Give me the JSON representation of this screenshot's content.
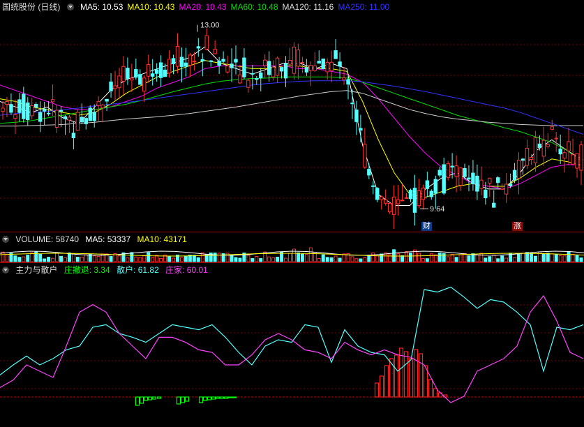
{
  "colors": {
    "up": "#ff3232",
    "down": "#54ffff",
    "ma5": "#ffffff",
    "ma10": "#ffff00",
    "ma20": "#ff00ff",
    "ma60": "#00e000",
    "ma120": "#cccccc",
    "ma250": "#3333ff",
    "grid": "#7a0000",
    "retreat": "#00ff00"
  },
  "price_panel": {
    "title": "国统股份 (日线)",
    "ma": [
      {
        "label": "MA5: 10.53",
        "color": "#ffffff"
      },
      {
        "label": "MA10: 10.43",
        "color": "#ffff00"
      },
      {
        "label": "MA20: 10.43",
        "color": "#ff00ff"
      },
      {
        "label": "MA60: 10.48",
        "color": "#00e000"
      },
      {
        "label": "MA120: 11.16",
        "color": "#dddddd"
      },
      {
        "label": "MA250: 11.00",
        "color": "#3333ff"
      }
    ],
    "high_label": "13.00",
    "low_label": "9.64",
    "tag_cai": "财",
    "tag_zhang": "涨"
  },
  "volume_panel": {
    "label": "VOLUME: 58740",
    "ma5": "MA5: 53337",
    "ma10": "MA10: 43171"
  },
  "indicator_panel": {
    "title": "主力与散户",
    "retreat": "庄撤退: 3.34",
    "retail": "散户: 61.82",
    "dealer": "庄家: 60.01"
  },
  "chart_data": {
    "type": "line",
    "title": "国统股份 (日线)",
    "price_extremes": {
      "high": 13.0,
      "low": 9.64
    },
    "last_values": {
      "MA5": 10.53,
      "MA10": 10.43,
      "MA20": 10.43,
      "MA60": 10.48,
      "MA120": 11.16,
      "MA250": 11.0
    },
    "series": [
      {
        "name": "MA5",
        "values": [
          11.6,
          11.5,
          11.4,
          11.5,
          11.3,
          11.2,
          11.5,
          11.8,
          12.0,
          12.1,
          12.2,
          12.3,
          12.4,
          12.6,
          12.3,
          12.2,
          12.1,
          12.2,
          12.3,
          12.3,
          12.2,
          12.3,
          12.2,
          10.8,
          9.9,
          9.7,
          9.7,
          10.0,
          10.2,
          10.3,
          10.1,
          10.0,
          10.0,
          10.3,
          10.7,
          10.9,
          10.7,
          10.53
        ]
      },
      {
        "name": "MA10",
        "values": [
          11.65,
          11.6,
          11.5,
          11.45,
          11.4,
          11.35,
          11.4,
          11.55,
          11.75,
          11.9,
          12.05,
          12.15,
          12.25,
          12.35,
          12.3,
          12.25,
          12.2,
          12.2,
          12.25,
          12.25,
          12.2,
          12.2,
          12.15,
          11.6,
          10.9,
          10.3,
          9.9,
          9.85,
          9.95,
          10.05,
          10.1,
          10.05,
          10.05,
          10.2,
          10.4,
          10.55,
          10.5,
          10.43
        ]
      },
      {
        "name": "MA20",
        "values": [
          11.9,
          11.8,
          11.7,
          11.6,
          11.5,
          11.45,
          11.45,
          11.5,
          11.6,
          11.7,
          11.85,
          11.95,
          12.05,
          12.2,
          12.25,
          12.25,
          12.25,
          12.25,
          12.25,
          12.2,
          12.2,
          12.15,
          12.1,
          11.95,
          11.65,
          11.3,
          10.95,
          10.65,
          10.4,
          10.25,
          10.1,
          10.05,
          10.0,
          10.1,
          10.25,
          10.4,
          10.45,
          10.43
        ]
      },
      {
        "name": "MA60",
        "values": [
          11.2,
          11.22,
          11.25,
          11.3,
          11.35,
          11.4,
          11.45,
          11.5,
          11.55,
          11.62,
          11.7,
          11.78,
          11.85,
          11.92,
          11.97,
          12.0,
          12.02,
          12.03,
          12.05,
          12.05,
          12.05,
          12.05,
          12.03,
          11.95,
          11.85,
          11.75,
          11.65,
          11.55,
          11.45,
          11.35,
          11.27,
          11.2,
          11.12,
          11.05,
          10.95,
          10.85,
          10.7,
          10.48
        ]
      },
      {
        "name": "MA120",
        "values": [
          11.15,
          11.15,
          11.16,
          11.17,
          11.18,
          11.2,
          11.22,
          11.25,
          11.28,
          11.3,
          11.32,
          11.35,
          11.38,
          11.42,
          11.46,
          11.5,
          11.55,
          11.6,
          11.65,
          11.7,
          11.74,
          11.78,
          11.8,
          11.75,
          11.65,
          11.55,
          11.45,
          11.38,
          11.32,
          11.28,
          11.25,
          11.22,
          11.2,
          11.18,
          11.17,
          11.16,
          11.16,
          11.16
        ]
      },
      {
        "name": "MA250",
        "values": [
          11.35,
          11.38,
          11.4,
          11.42,
          11.45,
          11.48,
          11.52,
          11.55,
          11.58,
          11.62,
          11.66,
          11.7,
          11.74,
          11.78,
          11.82,
          11.86,
          11.9,
          11.93,
          11.95,
          11.97,
          11.98,
          11.98,
          11.98,
          11.96,
          11.92,
          11.88,
          11.83,
          11.78,
          11.72,
          11.66,
          11.6,
          11.54,
          11.48,
          11.4,
          11.3,
          11.2,
          11.1,
          11.0
        ]
      }
    ],
    "indicator": [
      {
        "name": "散户",
        "values": [
          22,
          30,
          37,
          30,
          35,
          42,
          45,
          60,
          62,
          55,
          52,
          48,
          55,
          62,
          60,
          58,
          62,
          52,
          40,
          30,
          45,
          50,
          48,
          62,
          60,
          32,
          58,
          45,
          40,
          38,
          25,
          34,
          90,
          88,
          92,
          84,
          75,
          82,
          80,
          72,
          62,
          25,
          60,
          58,
          62
        ]
      },
      {
        "name": "庄家",
        "values": [
          12,
          18,
          30,
          25,
          20,
          45,
          72,
          78,
          72,
          55,
          45,
          35,
          52,
          52,
          48,
          42,
          40,
          30,
          30,
          38,
          50,
          55,
          50,
          42,
          40,
          35,
          48,
          42,
          38,
          42,
          38,
          36,
          30,
          10,
          0,
          5,
          25,
          30,
          35,
          45,
          72,
          85,
          65,
          40,
          35
        ]
      }
    ]
  }
}
